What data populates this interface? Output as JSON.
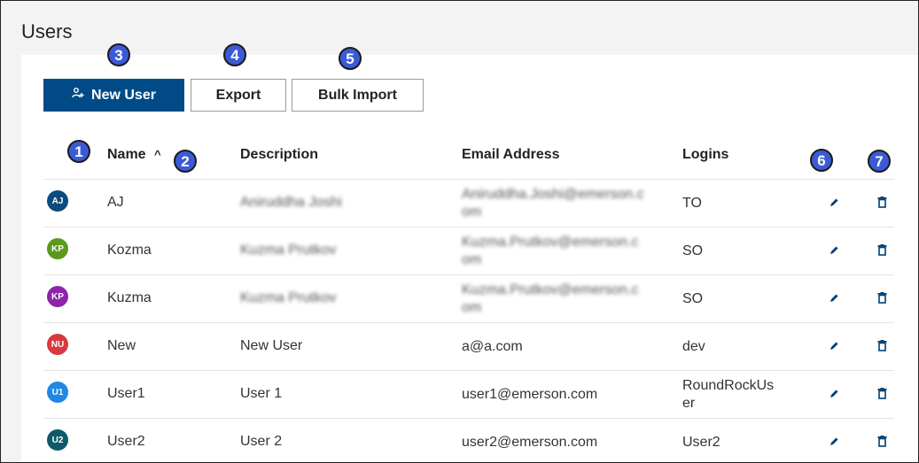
{
  "page": {
    "title": "Users"
  },
  "toolbar": {
    "new_user_label": "New User",
    "export_label": "Export",
    "bulk_import_label": "Bulk Import"
  },
  "callouts": [
    "1",
    "2",
    "3",
    "4",
    "5",
    "6",
    "7"
  ],
  "table": {
    "headers": {
      "name": "Name",
      "sort_indicator": "^",
      "description": "Description",
      "email": "Email Address",
      "logins": "Logins"
    },
    "rows": [
      {
        "initials": "AJ",
        "avatar_color": "#0d4a7d",
        "name": "AJ",
        "description": "Aniruddha Joshi",
        "email_line1": "Aniruddha.Joshi@emerson.c",
        "email_line2": "om",
        "logins_line1": "TO",
        "logins_line2": ""
      },
      {
        "initials": "KP",
        "avatar_color": "#5a9a1c",
        "name": "Kozma",
        "description": "Kuzma Prutkov",
        "email_line1": "Kuzma.Prutkov@emerson.c",
        "email_line2": "om",
        "logins_line1": "SO",
        "logins_line2": ""
      },
      {
        "initials": "KP",
        "avatar_color": "#8e24aa",
        "name": "Kuzma",
        "description": "Kuzma Prutkov",
        "email_line1": "Kuzma.Prutkov@emerson.c",
        "email_line2": "om",
        "logins_line1": "SO",
        "logins_line2": ""
      },
      {
        "initials": "NU",
        "avatar_color": "#d63a3f",
        "name": "New",
        "description": "New User",
        "email_line1": "a@a.com",
        "email_line2": "",
        "logins_line1": "dev",
        "logins_line2": ""
      },
      {
        "initials": "U1",
        "avatar_color": "#1e88e5",
        "name": "User1",
        "description": "User 1",
        "email_line1": "user1@emerson.com",
        "email_line2": "",
        "logins_line1": "RoundRockUs",
        "logins_line2": "er"
      },
      {
        "initials": "U2",
        "avatar_color": "#0e5a6a",
        "name": "User2",
        "description": "User 2",
        "email_line1": "user2@emerson.com",
        "email_line2": "",
        "logins_line1": "User2",
        "logins_line2": ""
      }
    ]
  },
  "colors": {
    "primary": "#004b87",
    "callout": "#3b5bd6",
    "icon": "#003f73"
  },
  "icons": {
    "new_user": "add-user-icon",
    "edit": "pencil-icon",
    "delete": "trash-icon"
  }
}
